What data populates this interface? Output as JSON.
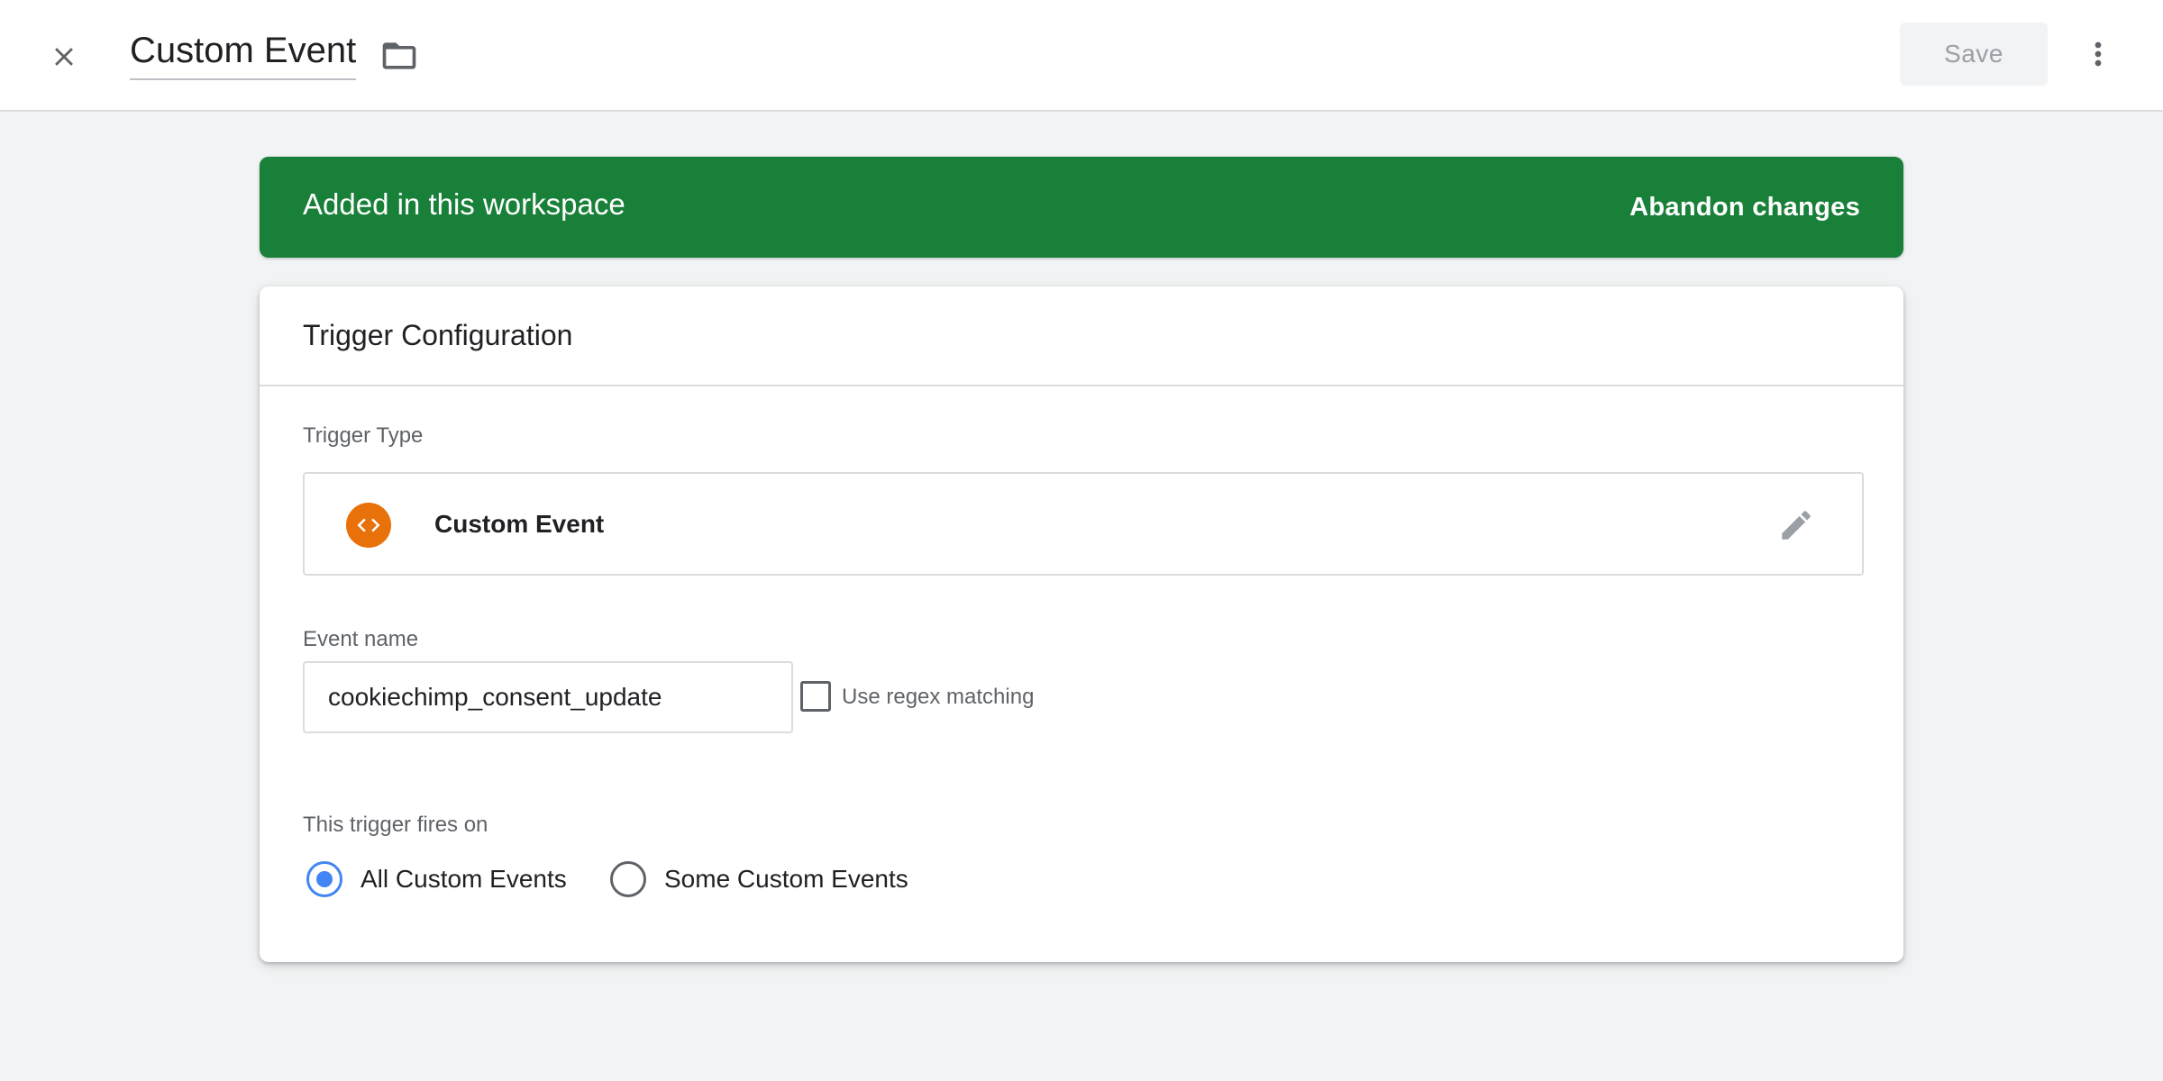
{
  "header": {
    "title": "Custom Event",
    "save_label": "Save",
    "icons": [
      "close-icon",
      "folder-icon",
      "more-vert-icon"
    ]
  },
  "banner": {
    "text": "Added in this workspace",
    "action": "Abandon changes",
    "color": "#188038"
  },
  "card": {
    "title": "Trigger Configuration",
    "trigger_type": {
      "label": "Trigger Type",
      "value": "Custom Event",
      "icon": "code-brackets-icon",
      "icon_color": "#e8710a"
    },
    "event_name": {
      "label": "Event name",
      "value": "cookiechimp_consent_update"
    },
    "regex": {
      "label": "Use regex matching",
      "checked": false
    },
    "fires_on": {
      "label": "This trigger fires on",
      "options": [
        {
          "label": "All Custom Events",
          "selected": true
        },
        {
          "label": "Some Custom Events",
          "selected": false
        }
      ]
    }
  },
  "colors": {
    "accent": "#4285f4",
    "background": "#f1f3f4"
  }
}
